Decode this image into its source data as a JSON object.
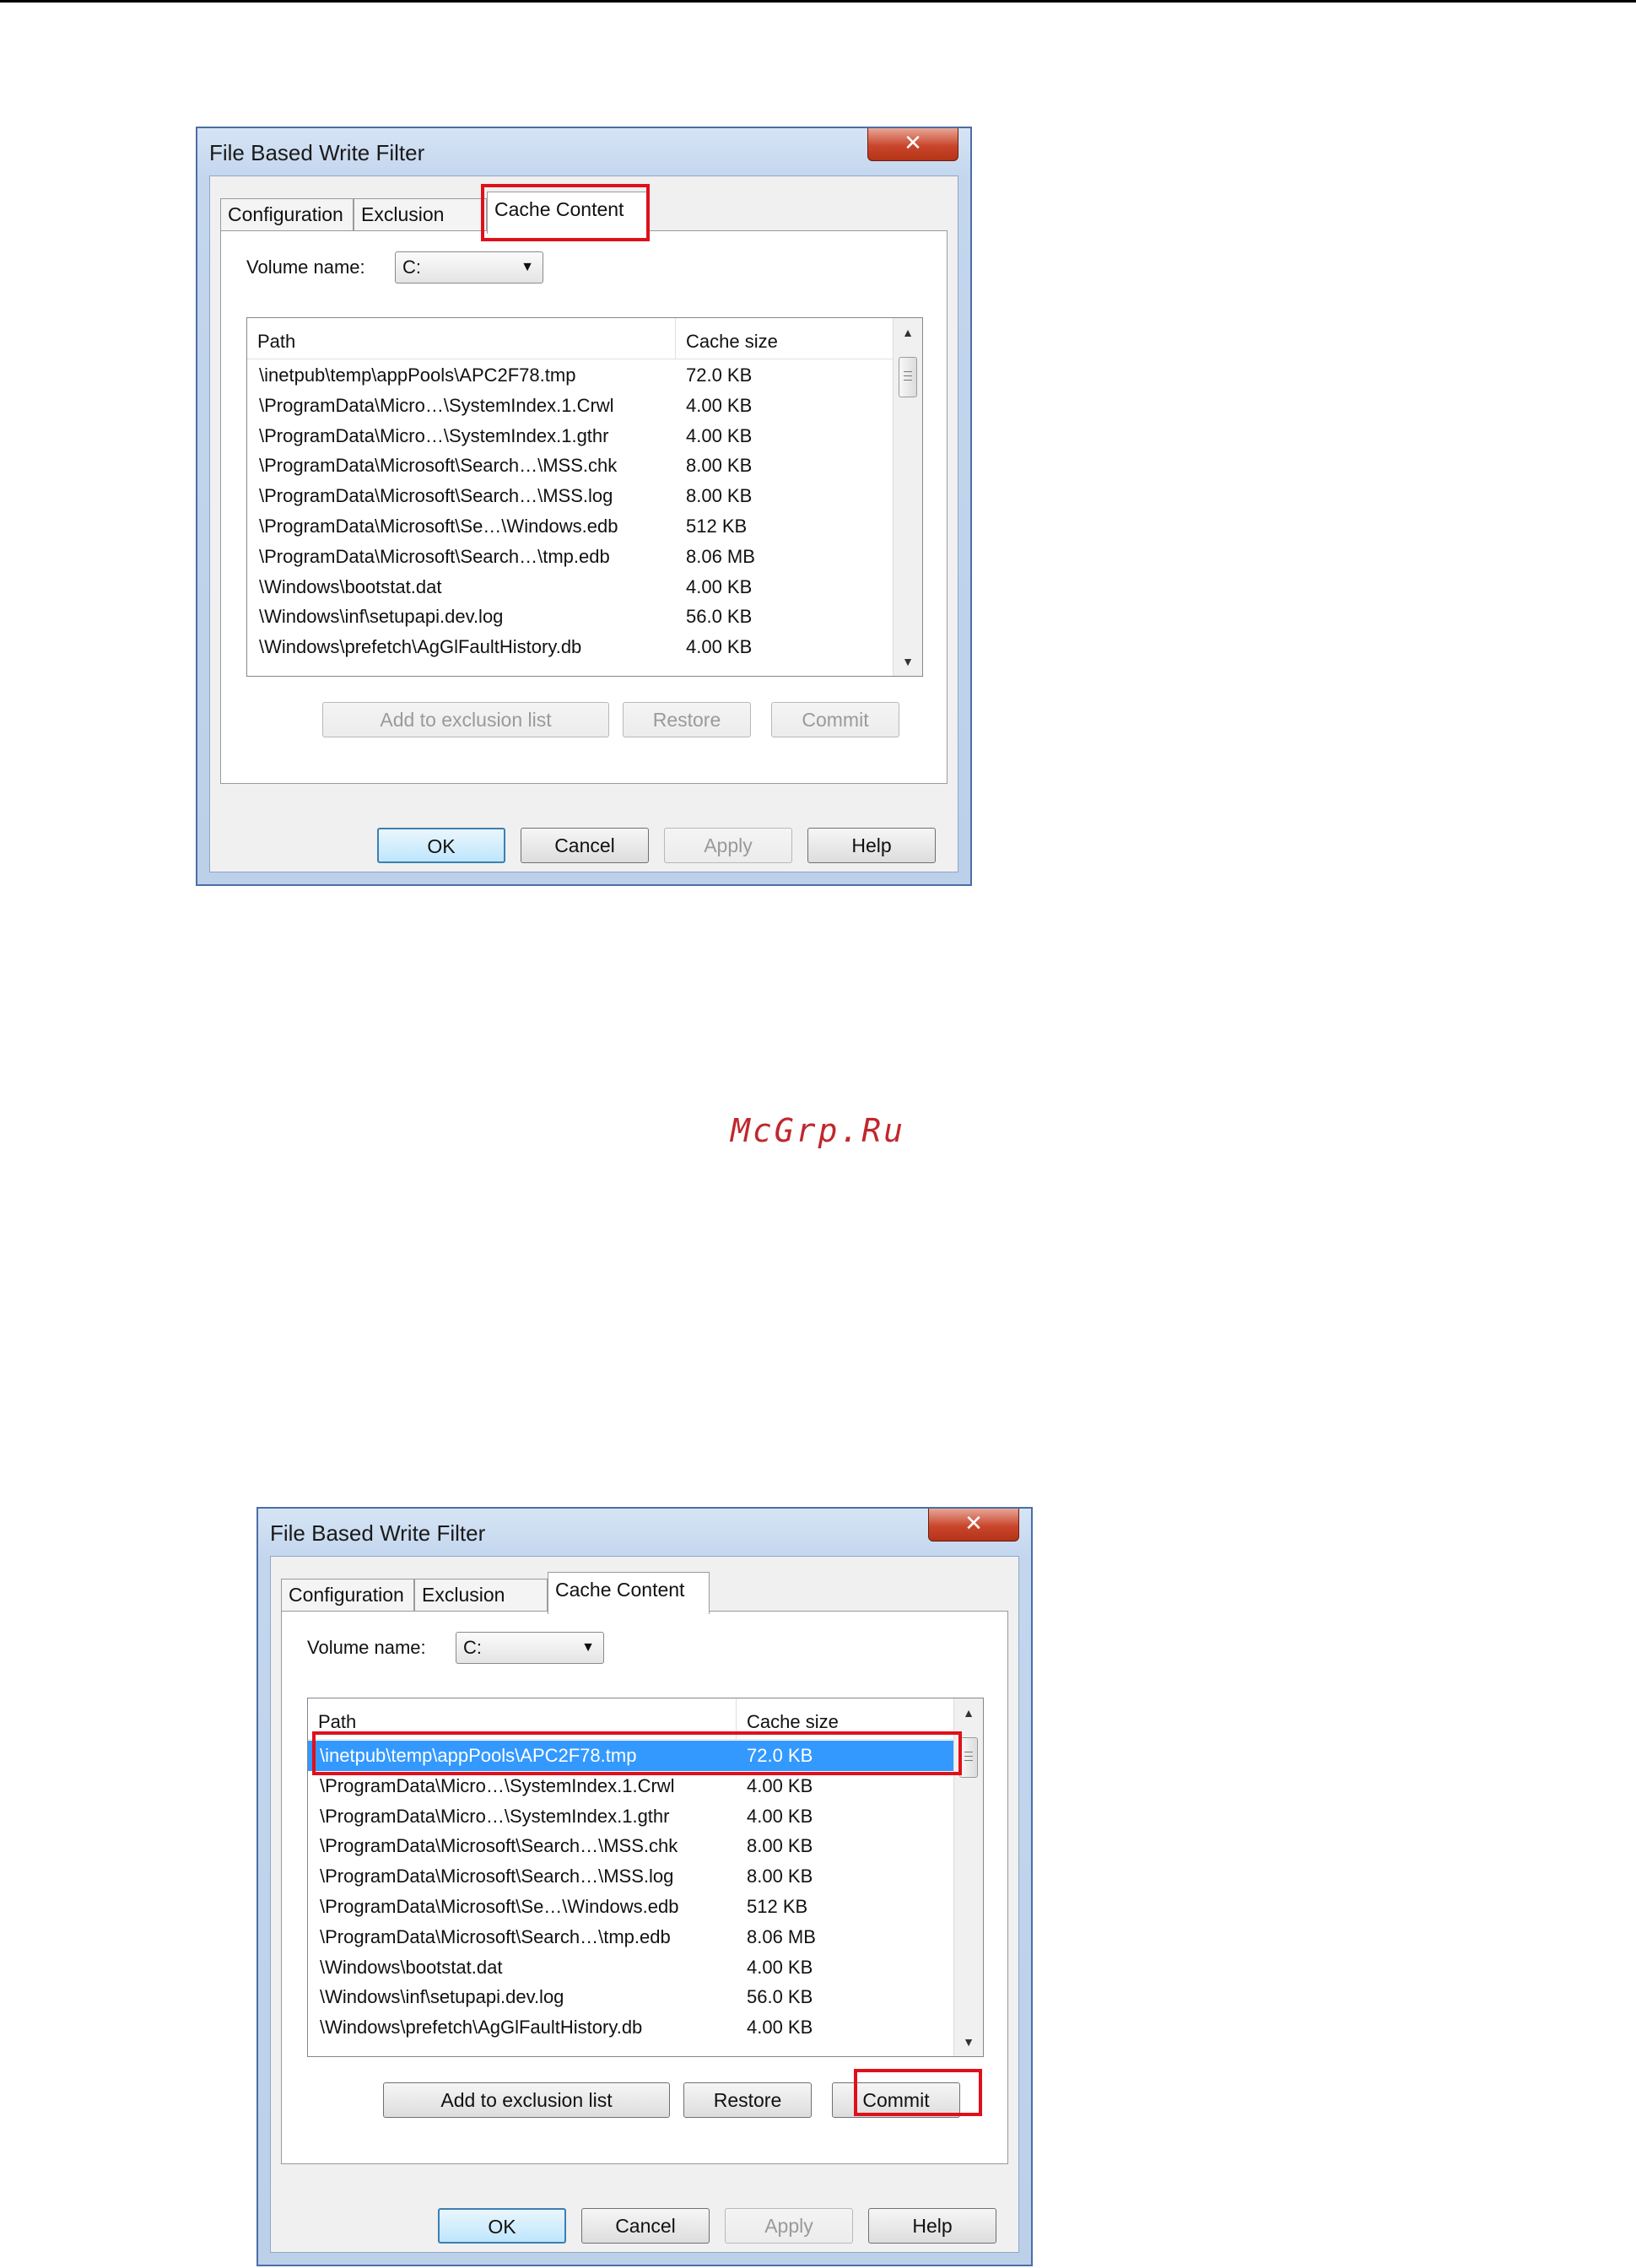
{
  "watermark": "McGrp.Ru",
  "dialogs": [
    {
      "title": "File Based Write Filter",
      "close_glyph": "✕",
      "tabs": [
        "Configuration",
        "Exclusion List",
        "Cache Content"
      ],
      "active_tab": "Cache Content",
      "volume": {
        "label": "Volume name:",
        "value": "C:"
      },
      "list": {
        "columns": [
          "Path",
          "Cache size"
        ],
        "selected_row": null,
        "rows": [
          {
            "path": "\\inetpub\\temp\\appPools\\APC2F78.tmp",
            "size": "72.0 KB"
          },
          {
            "path": "\\ProgramData\\Micro…\\SystemIndex.1.Crwl",
            "size": "4.00 KB"
          },
          {
            "path": "\\ProgramData\\Micro…\\SystemIndex.1.gthr",
            "size": "4.00 KB"
          },
          {
            "path": "\\ProgramData\\Microsoft\\Search…\\MSS.chk",
            "size": "8.00 KB"
          },
          {
            "path": "\\ProgramData\\Microsoft\\Search…\\MSS.log",
            "size": "8.00 KB"
          },
          {
            "path": "\\ProgramData\\Microsoft\\Se…\\Windows.edb",
            "size": "512 KB"
          },
          {
            "path": "\\ProgramData\\Microsoft\\Search…\\tmp.edb",
            "size": "8.06 MB"
          },
          {
            "path": "\\Windows\\bootstat.dat",
            "size": "4.00 KB"
          },
          {
            "path": "\\Windows\\inf\\setupapi.dev.log",
            "size": "56.0 KB"
          },
          {
            "path": "\\Windows\\prefetch\\AgGlFaultHistory.db",
            "size": "4.00 KB"
          }
        ]
      },
      "actions": [
        "Add to exclusion list",
        "Restore",
        "Commit"
      ],
      "actions_enabled": false,
      "footer": [
        "OK",
        "Cancel",
        "Apply",
        "Help"
      ],
      "highlight": "tab"
    },
    {
      "title": "File Based Write Filter",
      "close_glyph": "✕",
      "tabs": [
        "Configuration",
        "Exclusion List",
        "Cache Content"
      ],
      "active_tab": "Cache Content",
      "volume": {
        "label": "Volume name:",
        "value": "C:"
      },
      "list": {
        "columns": [
          "Path",
          "Cache size"
        ],
        "selected_row": 0,
        "rows": [
          {
            "path": "\\inetpub\\temp\\appPools\\APC2F78.tmp",
            "size": "72.0 KB"
          },
          {
            "path": "\\ProgramData\\Micro…\\SystemIndex.1.Crwl",
            "size": "4.00 KB"
          },
          {
            "path": "\\ProgramData\\Micro…\\SystemIndex.1.gthr",
            "size": "4.00 KB"
          },
          {
            "path": "\\ProgramData\\Microsoft\\Search…\\MSS.chk",
            "size": "8.00 KB"
          },
          {
            "path": "\\ProgramData\\Microsoft\\Search…\\MSS.log",
            "size": "8.00 KB"
          },
          {
            "path": "\\ProgramData\\Microsoft\\Se…\\Windows.edb",
            "size": "512 KB"
          },
          {
            "path": "\\ProgramData\\Microsoft\\Search…\\tmp.edb",
            "size": "8.06 MB"
          },
          {
            "path": "\\Windows\\bootstat.dat",
            "size": "4.00 KB"
          },
          {
            "path": "\\Windows\\inf\\setupapi.dev.log",
            "size": "56.0 KB"
          },
          {
            "path": "\\Windows\\prefetch\\AgGlFaultHistory.db",
            "size": "4.00 KB"
          }
        ]
      },
      "actions": [
        "Add to exclusion list",
        "Restore",
        "Commit"
      ],
      "actions_enabled": true,
      "footer": [
        "OK",
        "Cancel",
        "Apply",
        "Help"
      ],
      "highlight": "row-and-commit"
    }
  ],
  "colors": {
    "highlight_box": "#e0101a",
    "selection": "#3399ff",
    "watermark": "#c0272d"
  }
}
